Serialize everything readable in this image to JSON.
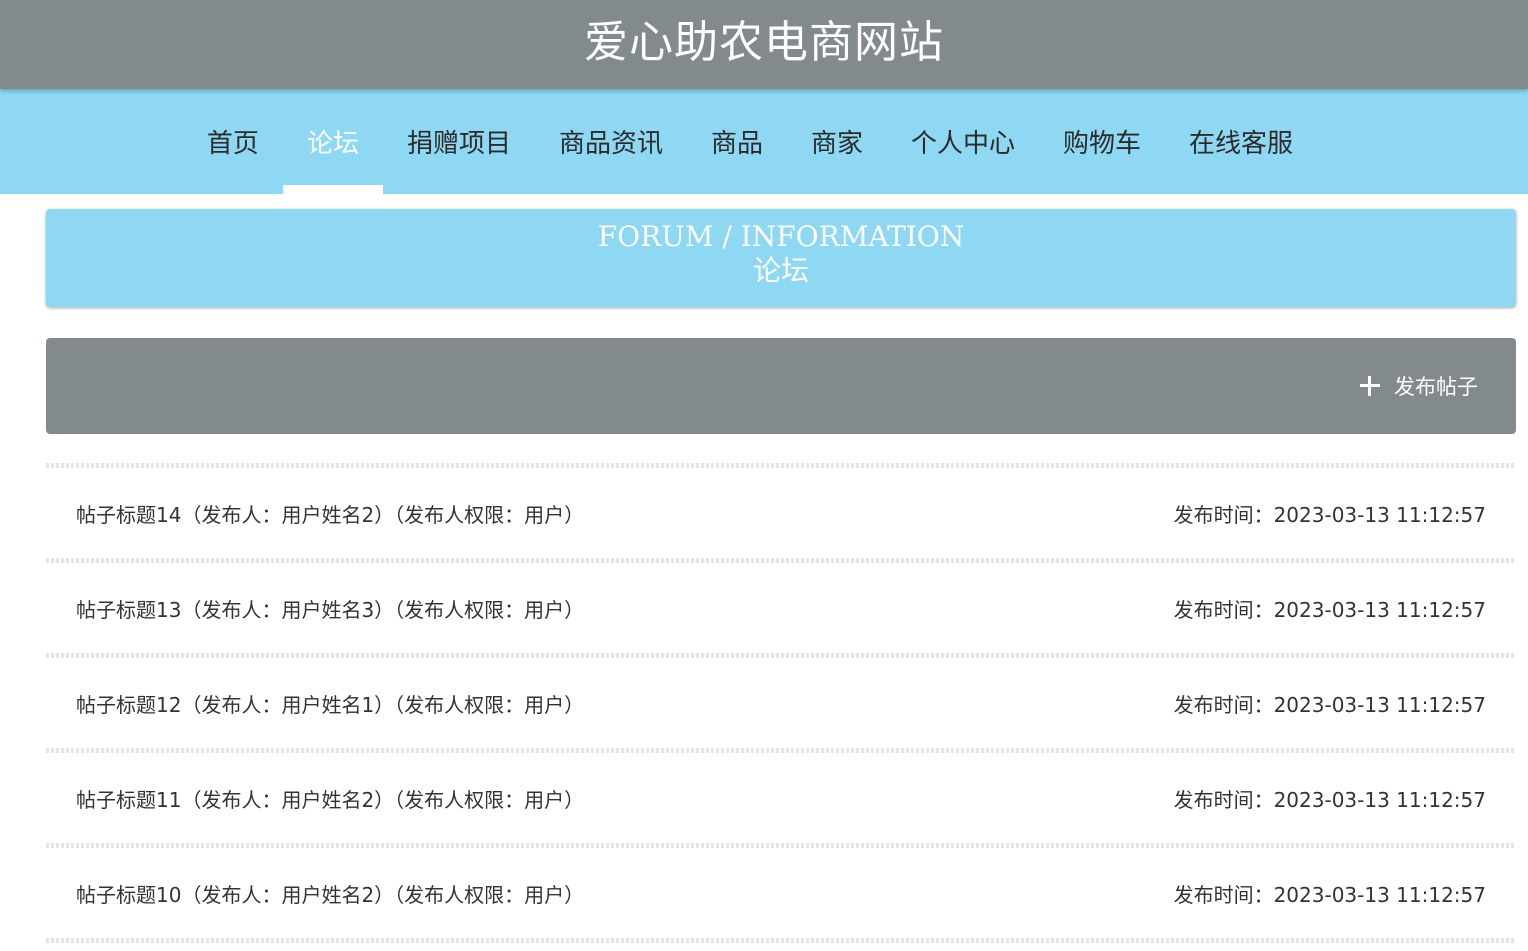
{
  "site": {
    "title": "爱心助农电商网站"
  },
  "nav": {
    "items": [
      {
        "label": "首页"
      },
      {
        "label": "论坛"
      },
      {
        "label": "捐赠项目"
      },
      {
        "label": "商品资讯"
      },
      {
        "label": "商品"
      },
      {
        "label": "商家"
      },
      {
        "label": "个人中心"
      },
      {
        "label": "购物车"
      },
      {
        "label": "在线客服"
      }
    ],
    "active": "论坛"
  },
  "banner": {
    "en": "FORUM / INFORMATION",
    "cn": "论坛"
  },
  "toolbar": {
    "post_button_label": "发布帖子",
    "post_button_icon": "plus-icon"
  },
  "posts": [
    {
      "title": "帖子标题14（发布人：用户姓名2）（发布人权限：用户）",
      "time": "发布时间：2023-03-13 11:12:57"
    },
    {
      "title": "帖子标题13（发布人：用户姓名3）（发布人权限：用户）",
      "time": "发布时间：2023-03-13 11:12:57"
    },
    {
      "title": "帖子标题12（发布人：用户姓名1）（发布人权限：用户）",
      "time": "发布时间：2023-03-13 11:12:57"
    },
    {
      "title": "帖子标题11（发布人：用户姓名2）（发布人权限：用户）",
      "time": "发布时间：2023-03-13 11:12:57"
    },
    {
      "title": "帖子标题10（发布人：用户姓名2）（发布人权限：用户）",
      "time": "发布时间：2023-03-13 11:12:57"
    }
  ],
  "colors": {
    "header": "#838a8d",
    "nav": "#8ed8f3",
    "active_text": "#ffffff"
  }
}
